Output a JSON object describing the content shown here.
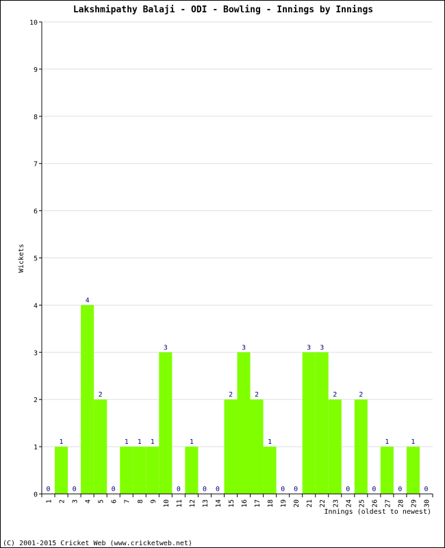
{
  "chart_data": {
    "type": "bar",
    "title": "Lakshmipathy Balaji - ODI - Bowling - Innings by Innings",
    "xlabel": "Innings (oldest to newest)",
    "ylabel": "Wickets",
    "ylim": [
      0,
      10
    ],
    "yticks": [
      0,
      1,
      2,
      3,
      4,
      5,
      6,
      7,
      8,
      9,
      10
    ],
    "grid": true,
    "categories": [
      "1",
      "2",
      "3",
      "4",
      "5",
      "6",
      "7",
      "8",
      "9",
      "10",
      "11",
      "12",
      "13",
      "14",
      "15",
      "16",
      "17",
      "18",
      "19",
      "20",
      "21",
      "22",
      "23",
      "24",
      "25",
      "26",
      "27",
      "28",
      "29",
      "30"
    ],
    "values": [
      0,
      1,
      0,
      4,
      2,
      0,
      1,
      1,
      1,
      3,
      0,
      1,
      0,
      0,
      2,
      3,
      2,
      1,
      0,
      0,
      3,
      3,
      2,
      0,
      2,
      0,
      1,
      0,
      1,
      0
    ],
    "bar_color": "#80ff00",
    "label_color": "#000080",
    "grid_color": "#dddddd"
  },
  "footer": "(C) 2001-2015 Cricket Web (www.cricketweb.net)"
}
